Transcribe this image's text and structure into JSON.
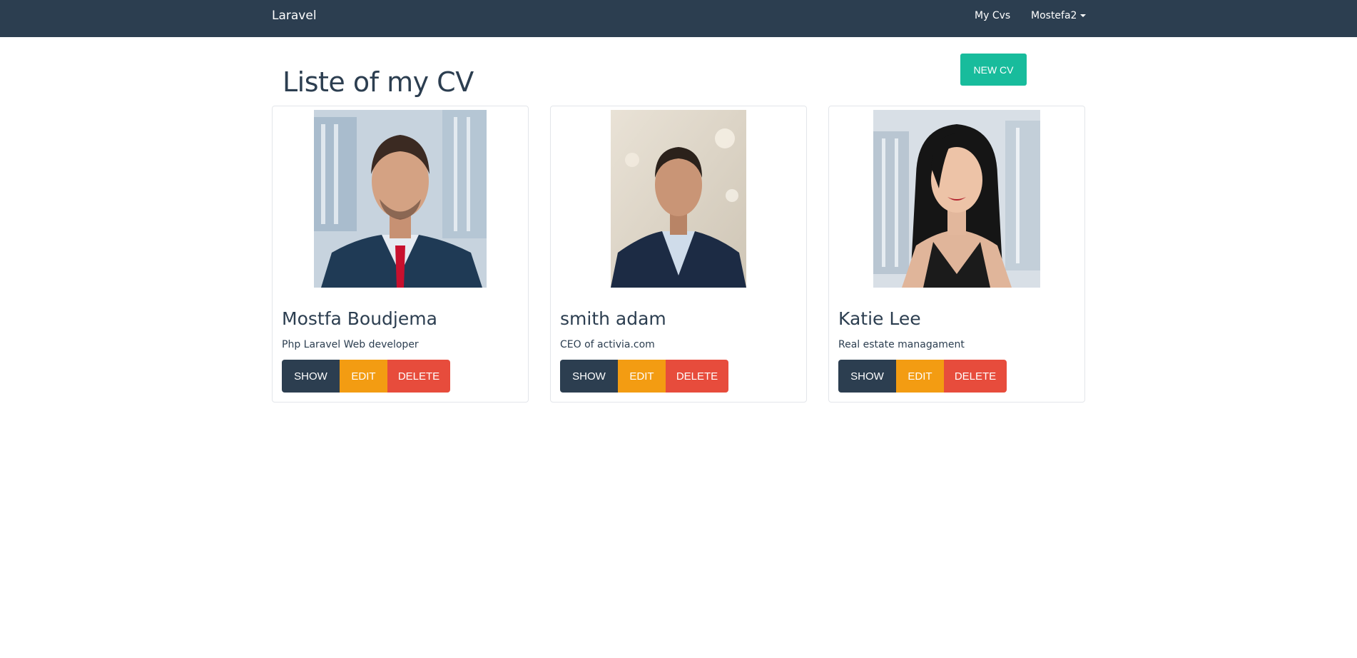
{
  "navbar": {
    "brand": "Laravel",
    "links": [
      "My Cvs",
      "Mostefa2"
    ]
  },
  "page": {
    "title": "Liste of my CV",
    "new_cv_label": "NEW CV"
  },
  "cards": [
    {
      "name": "Mostfa Boudjema",
      "description": "Php Laravel Web developer",
      "photo": "man-in-suit-red-tie-photo"
    },
    {
      "name": "smith adam",
      "description": "CEO of activia.com",
      "photo": "young-man-in-suit-photo"
    },
    {
      "name": "Katie Lee",
      "description": "Real estate managament",
      "photo": "woman-black-top-photo"
    }
  ],
  "actions": {
    "show": "SHOW",
    "edit": "EDIT",
    "delete": "DELETE"
  },
  "colors": {
    "navbar": "#2c3e50",
    "new_button": "#18bc9c",
    "show_button": "#2c3e50",
    "edit_button": "#f39c12",
    "delete_button": "#e74c3c"
  }
}
